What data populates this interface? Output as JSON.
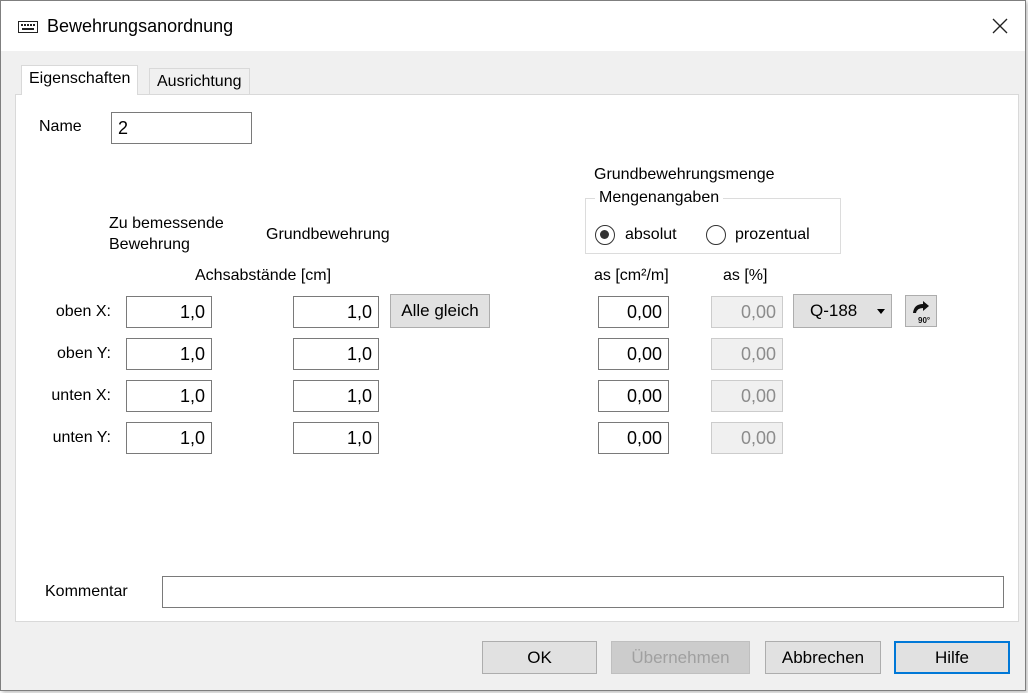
{
  "window": {
    "title": "Bewehrungsanordnung",
    "icon": "keyboard-icon",
    "close_icon": "close-icon"
  },
  "tabs": [
    {
      "label": "Eigenschaften",
      "active": true
    },
    {
      "label": "Ausrichtung",
      "active": false
    }
  ],
  "name": {
    "label": "Name",
    "value": "2"
  },
  "headers": {
    "zu_bemessende_line1": "Zu bemessende",
    "zu_bemessende_line2": "Bewehrung",
    "grundbewehrung": "Grundbewehrung",
    "achsabstaende": "Achsabstände [cm]",
    "grundbewehrungsmenge": "Grundbewehrungsmenge",
    "mengenangaben": "Mengenangaben",
    "as_abs": "as [cm²/m]",
    "as_pct": "as [%]"
  },
  "radio": {
    "absolut": {
      "label": "absolut",
      "selected": true
    },
    "prozentual": {
      "label": "prozentual",
      "selected": false
    }
  },
  "rows": [
    {
      "label": "oben X:",
      "zu": "1,0",
      "grund": "1,0",
      "as_abs": "0,00",
      "as_pct": "0,00"
    },
    {
      "label": "oben Y:",
      "zu": "1,0",
      "grund": "1,0",
      "as_abs": "0,00",
      "as_pct": "0,00"
    },
    {
      "label": "unten X:",
      "zu": "1,0",
      "grund": "1,0",
      "as_abs": "0,00",
      "as_pct": "0,00"
    },
    {
      "label": "unten Y:",
      "zu": "1,0",
      "grund": "1,0",
      "as_abs": "0,00",
      "as_pct": "0,00"
    }
  ],
  "alle_gleich": "Alle gleich",
  "mesh_select": {
    "value": "Q-188"
  },
  "rotate_button": {
    "icon": "rotate-90-icon",
    "text": "90°"
  },
  "kommentar": {
    "label": "Kommentar",
    "value": ""
  },
  "buttons": {
    "ok": "OK",
    "apply": "Übernehmen",
    "cancel": "Abbrechen",
    "help": "Hilfe"
  },
  "colors": {
    "default_button_border": "#0078d7",
    "dialog_background": "#f0f0f0"
  }
}
